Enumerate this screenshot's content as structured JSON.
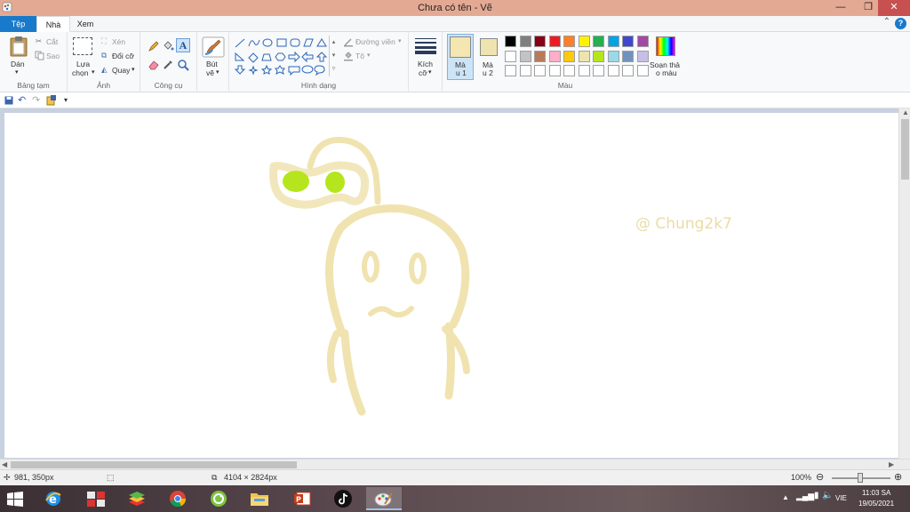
{
  "window": {
    "title": "Chưa có tên - Vẽ"
  },
  "tabs": {
    "file": "Tệp",
    "home": "Nhà",
    "view": "Xem"
  },
  "clipboard": {
    "paste": "Dán",
    "cut": "Cắt",
    "copy": "Sao",
    "label": "Bảng tạm"
  },
  "image": {
    "select_line1": "Lựa",
    "select_line2": "chọn",
    "crop": "Xén",
    "resize": "Đổi cỡ",
    "rotate": "Quay",
    "label": "Ảnh"
  },
  "tools": {
    "label": "Công cụ"
  },
  "brushes": {
    "line1": "Bút",
    "line2": "vẽ"
  },
  "shapes": {
    "outline": "Đường viền",
    "fill": "Tô",
    "label": "Hình dạng"
  },
  "size": {
    "line1": "Kích",
    "line2": "cỡ"
  },
  "colors": {
    "color1_line1": "Mà",
    "color1_line2": "u 1",
    "color2_line1": "Mà",
    "color2_line2": "u 2",
    "edit_line1": "Soạn thả",
    "edit_line2": "o màu",
    "label": "Màu",
    "color1": "#f3e6b3",
    "color2": "#efe4b0",
    "row1": [
      "#000000",
      "#7f7f7f",
      "#880015",
      "#ed1c24",
      "#ff7f27",
      "#fff200",
      "#22b14c",
      "#00a2e8",
      "#3f48cc",
      "#a349a4"
    ],
    "row2": [
      "#ffffff",
      "#c3c3c3",
      "#b97a57",
      "#ffaec9",
      "#ffc90e",
      "#efe4b0",
      "#b5e61d",
      "#99d9ea",
      "#7092be",
      "#c8bfe7"
    ]
  },
  "canvas": {
    "watermark": "@ Chung2k7",
    "stroke_color": "#f0e3b0",
    "fill_color": "#b5e61d"
  },
  "status": {
    "cursor": "981, 350px",
    "image_size": "4104 × 2824px",
    "zoom": "100%"
  },
  "taskbar": {
    "lang": "VIE",
    "time": "11:03 SA",
    "date": "19/05/2021"
  }
}
